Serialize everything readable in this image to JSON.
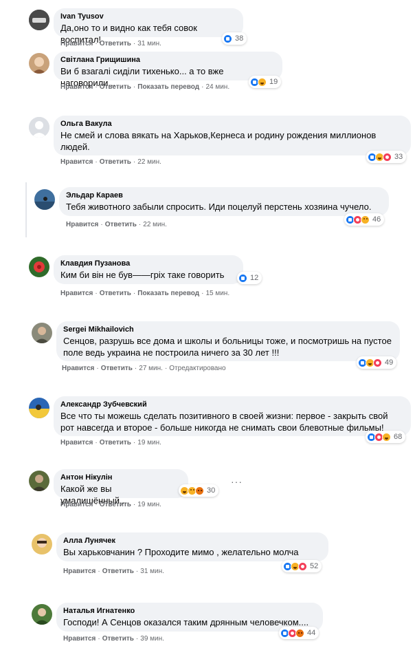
{
  "labels": {
    "like": "Нравится",
    "reply": "Ответить",
    "translate": "Показать перевод",
    "sep": "·"
  },
  "comments": [
    {
      "author": "Ivan Tyusov",
      "text": "Да,оно то и видно как тебя совок воспитал!",
      "time": "31 мин.",
      "reactions": [
        "like"
      ],
      "count": "38",
      "translate": false,
      "edited": ""
    },
    {
      "author": "Світлана Грищишина",
      "text": "Ви б взагалі сиділи тихенько... а то вже наговорили...",
      "time": "24 мин.",
      "reactions": [
        "like",
        "haha"
      ],
      "count": "19",
      "translate": true,
      "edited": ""
    },
    {
      "author": "Ольга Вакула",
      "text": "Не смей и слова вякать на Харьков,Кернеса и родину рождения миллионов людей.",
      "time": "22 мин.",
      "reactions": [
        "like",
        "haha",
        "love"
      ],
      "count": "33",
      "translate": false,
      "edited": ""
    },
    {
      "author": "Эльдар Караев",
      "text": "Тебя животного забыли спросить. Иди поцелуй перстень хозяина чучело.",
      "time": "22 мин.",
      "reactions": [
        "like",
        "love",
        "sad"
      ],
      "count": "46",
      "translate": false,
      "edited": ""
    },
    {
      "author": "Клавдия Пузанова",
      "text": "Ким би він не був——гріх таке говорить",
      "time": "15 мин.",
      "reactions": [
        "like"
      ],
      "count": "12",
      "translate": true,
      "edited": ""
    },
    {
      "author": "Sergei Mikhailovich",
      "text": "Сенцов, разрушь все дома и школы и больницы тоже, и посмотришь на пустое поле ведь украина не построила ничего за 30 лет !!!",
      "time": "27 мин.",
      "reactions": [
        "like",
        "haha",
        "love"
      ],
      "count": "49",
      "translate": false,
      "edited": "Отредактировано"
    },
    {
      "author": "Александр Зубчевский",
      "text": "Все что ты можешь сделать позитивного в своей жизни: первое - закрыть свой рот навсегда и второе - больше никогда не снимать свои блевотные фильмы!",
      "time": "19 мин.",
      "reactions": [
        "like",
        "love",
        "haha"
      ],
      "count": "68",
      "translate": false,
      "edited": ""
    },
    {
      "author": "Антон Нікулін",
      "text": "Какой же вы умалишённый....",
      "time": "19 мин.",
      "reactions": [
        "haha",
        "sad",
        "angry"
      ],
      "count": "30",
      "translate": false,
      "edited": "",
      "more": "···"
    },
    {
      "author": "Алла Лунячек",
      "text": "Вы харьковчанин ? Проходите мимо , желательно молча",
      "time": "31 мин.",
      "reactions": [
        "like",
        "haha",
        "love"
      ],
      "count": "52",
      "translate": false,
      "edited": ""
    },
    {
      "author": "Наталья Игнатенко",
      "text": "Господи! А Сенцов оказался таким дрянным человечком....",
      "time": "39 мин.",
      "reactions": [
        "like",
        "love",
        "angry"
      ],
      "count": "44",
      "translate": false,
      "edited": ""
    }
  ],
  "colors": {
    "bubble": "#f0f2f5",
    "meta": "#65676b",
    "like": "#1877f2",
    "love": "#f33e58",
    "haha": "#f7b125",
    "angry": "#e9710f"
  },
  "avatars": [
    "avatar-ivan",
    "avatar-svitlana",
    "avatar-olga",
    "avatar-eldar",
    "avatar-klavdia",
    "avatar-sergei",
    "avatar-alexandr",
    "avatar-anton",
    "avatar-alla",
    "avatar-natalia"
  ]
}
